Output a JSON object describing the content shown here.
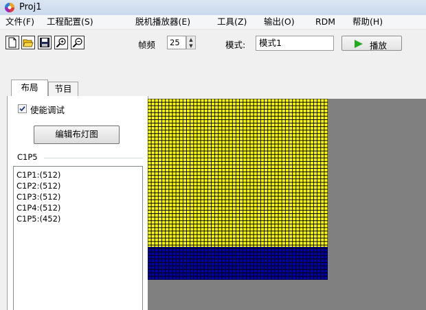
{
  "window": {
    "title": "Proj1"
  },
  "menu": [
    "文件(F)",
    "工程配置(S)",
    "脱机播放器(E)",
    "工具(Z)",
    "输出(O)",
    "RDM",
    "帮助(H)"
  ],
  "toolbar": {
    "icons": [
      "new-file-icon",
      "open-folder-icon",
      "save-icon",
      "zoom-in-icon",
      "zoom-out-icon"
    ],
    "fps_label": "帧频",
    "fps_value": "25",
    "mode_label": "模式:",
    "mode_value": "模式1",
    "play_label": "播放",
    "play_color": "#22aa22"
  },
  "tabs": [
    "布局",
    "节目"
  ],
  "layout_panel": {
    "enable_debug_label": "使能调试",
    "enable_debug_checked": true,
    "edit_button_label": "编辑布灯图",
    "group_label": "C1P5",
    "list_items": [
      "C1P1:(512)",
      "C1P2:(512)",
      "C1P3:(512)",
      "C1P4:(512)",
      "C1P5:(452)"
    ]
  },
  "canvas": {
    "grid_cols": 51,
    "grid_rows": 52,
    "yellow_rows": 42.6,
    "colors": {
      "background": "#808080",
      "lit": "#ffff00",
      "unlit": "#0000a8",
      "grid_line": "#000000"
    }
  }
}
